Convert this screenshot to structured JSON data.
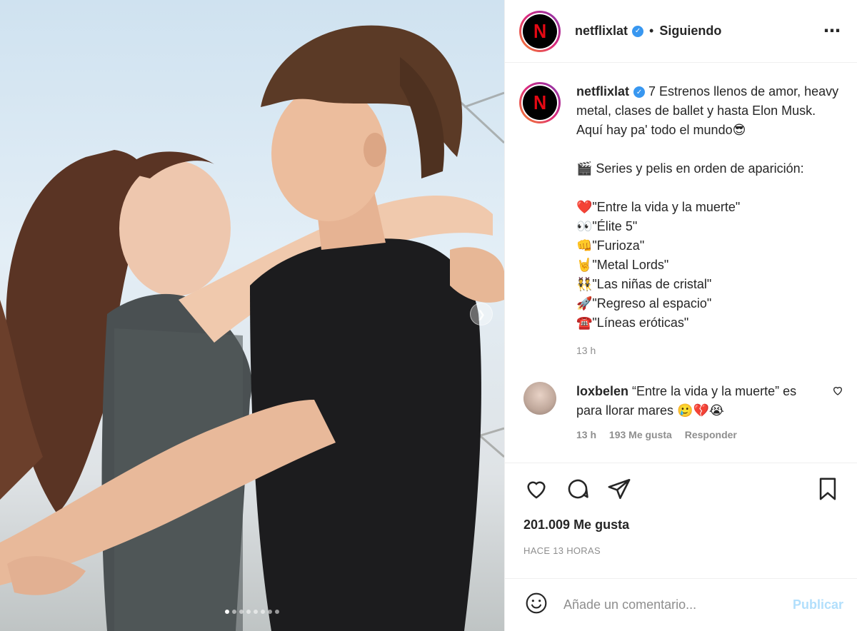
{
  "post": {
    "username": "netflixlat",
    "separator": "•",
    "follow_status": "Siguiendo",
    "more_icon": "more-horizontal-icon",
    "avatar_letter": "N",
    "brand_color": "#e50914",
    "verified_color": "#3897f0"
  },
  "caption": {
    "username": "netflixlat",
    "intro": "7 Estrenos llenos de amor, heavy metal, clases de ballet y hasta Elon Musk. Aquí hay pa' todo el mundo😎",
    "section_title": "🎬 Series y pelis en orden de aparición:",
    "items": [
      "❤️\"Entre la vida y la muerte\"",
      "👀\"Élite 5\"",
      "👊\"Furioza\"",
      "🤘\"Metal Lords\"",
      "👯\"Las niñas de cristal\"",
      "🚀\"Regreso al espacio\"",
      "☎️\"Líneas eróticas\""
    ],
    "time": "13 h"
  },
  "comment": {
    "username": "loxbelen",
    "text": "“Entre la vida y la muerte” es para llorar mares 🥲💔😭",
    "time": "13 h",
    "likes": "193 Me gusta",
    "reply": "Responder"
  },
  "actions": {
    "likes_count": "201.009 Me gusta",
    "posted_ago": "HACE 13 HORAS"
  },
  "add_comment": {
    "placeholder": "Añade un comentario...",
    "post_label": "Publicar"
  },
  "carousel": {
    "slide_count": 8,
    "active_index": 0
  }
}
